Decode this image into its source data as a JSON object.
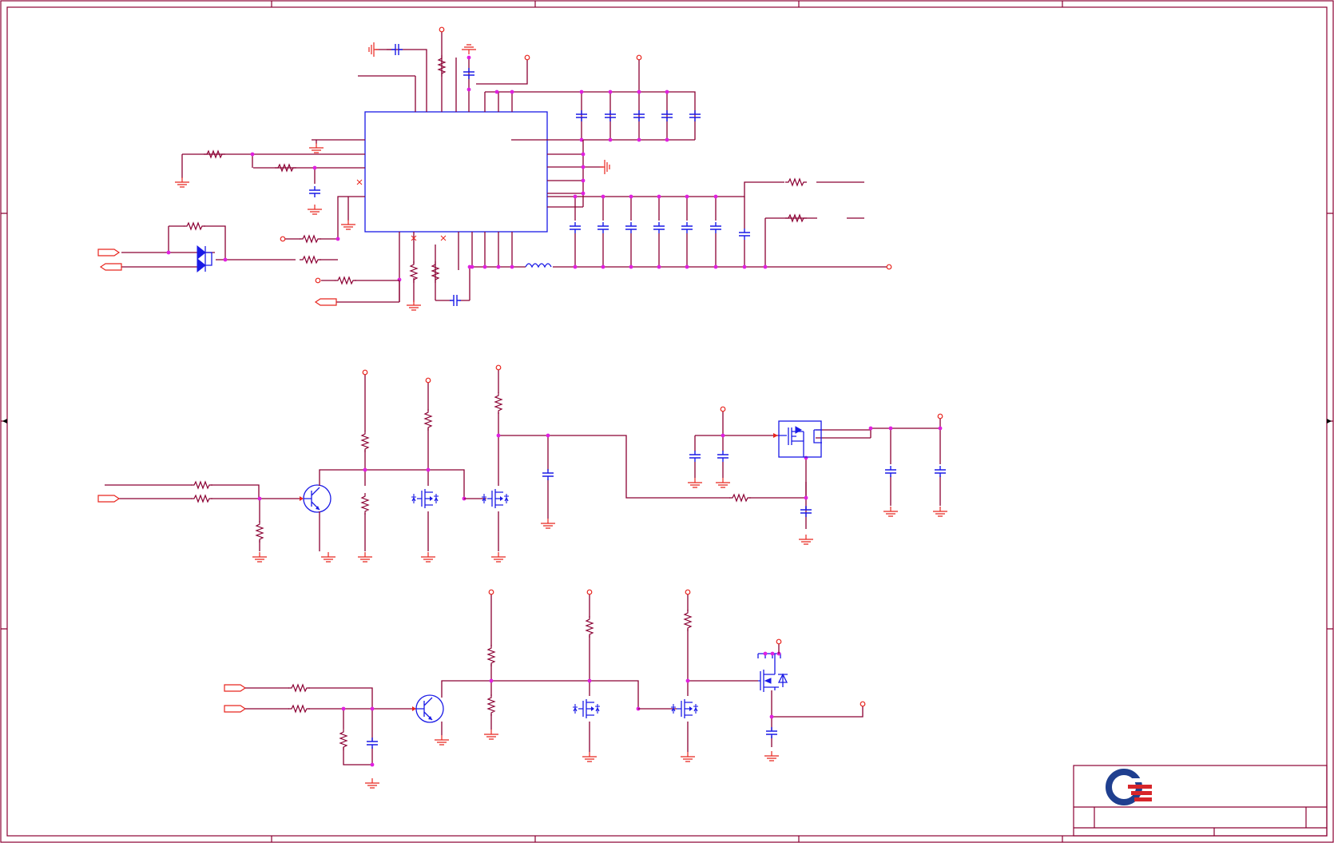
{
  "sheet": {
    "title_block": {
      "logo": "company-logo",
      "title_text": "",
      "revision_text": ""
    }
  },
  "colors": {
    "wire": "#8b0033",
    "component": "#1a1ae6",
    "port": "#e8261f",
    "junction": "#e020e0",
    "logo_blue": "#1f3f8f",
    "logo_red": "#d7262b"
  },
  "icons": [
    "resistor-icon",
    "capacitor-icon",
    "inductor-icon",
    "ground-icon",
    "power-port-icon",
    "npn-transistor-icon",
    "mosfet-icon",
    "diode-icon",
    "net-port-icon"
  ]
}
